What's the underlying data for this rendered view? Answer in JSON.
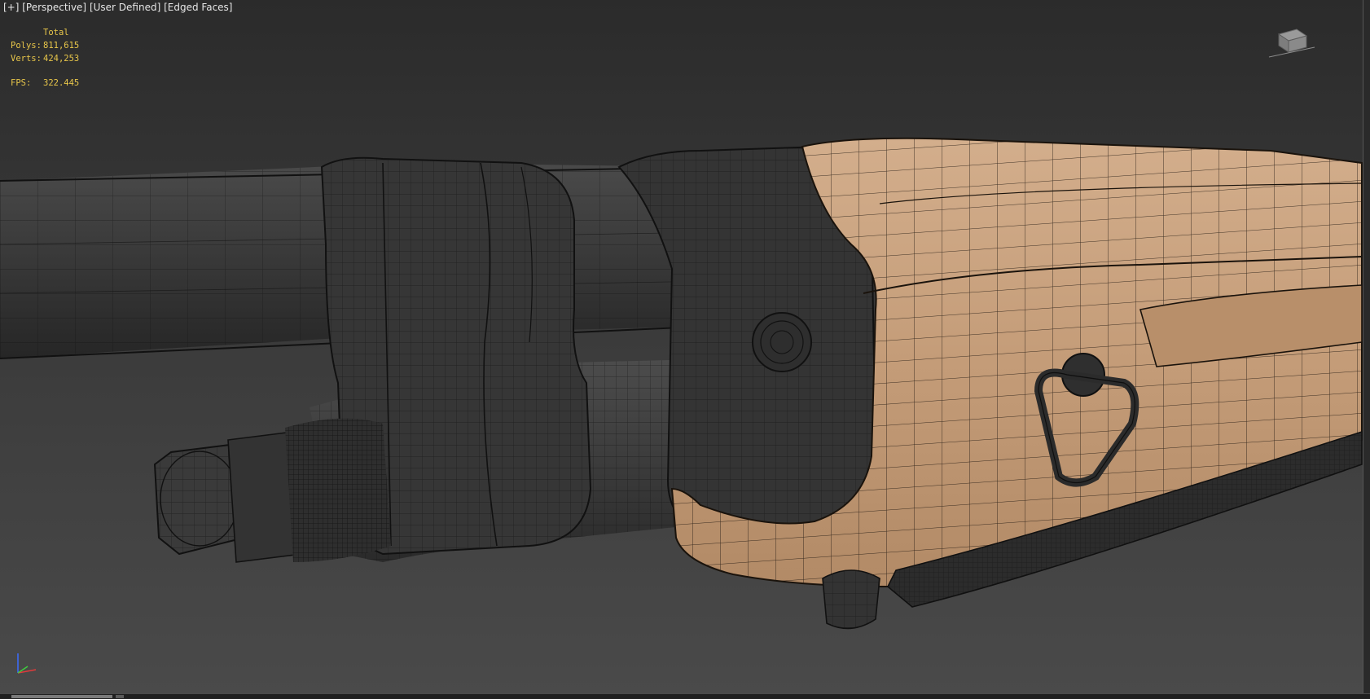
{
  "viewport": {
    "label_parts": [
      "[+]",
      "[Perspective]",
      "[User Defined]",
      "[Edged Faces]"
    ]
  },
  "stats": {
    "header": "Total",
    "polys_label": "Polys:",
    "polys_value": "811,615",
    "verts_label": "Verts:",
    "verts_value": "424,253",
    "fps_label": "FPS:",
    "fps_value": "322.445"
  },
  "icons": {
    "viewcube": "viewcube-icon",
    "axis": "axis-tripod-icon"
  },
  "colors": {
    "stats_text": "#e8c64a",
    "model_dark": "#3d3d3d",
    "model_tan": "#c9a27e",
    "wire": "#111111"
  }
}
